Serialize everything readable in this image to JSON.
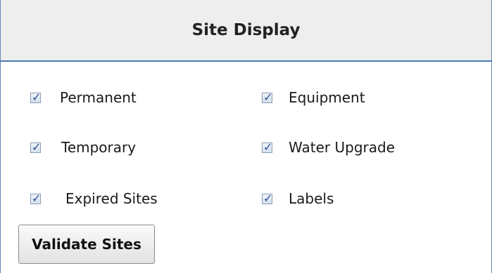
{
  "panel": {
    "title": "Site Display"
  },
  "options": {
    "permanent": {
      "label": "Permanent",
      "checked": true
    },
    "equipment": {
      "label": "Equipment",
      "checked": true
    },
    "temporary": {
      "label": "Temporary",
      "checked": true
    },
    "water_upgrade": {
      "label": "Water Upgrade",
      "checked": true
    },
    "expired_sites": {
      "label": "Expired Sites",
      "checked": true
    },
    "labels": {
      "label": "Labels",
      "checked": true
    }
  },
  "actions": {
    "validate_label": "Validate Sites"
  },
  "icons": {
    "checkbox_checked": "checkmark-icon",
    "checkmark_glyph": "✓"
  },
  "colors": {
    "border_accent": "#4a78b4",
    "header_background": "#eeeeee",
    "checkmark": "#2b4f8f"
  }
}
